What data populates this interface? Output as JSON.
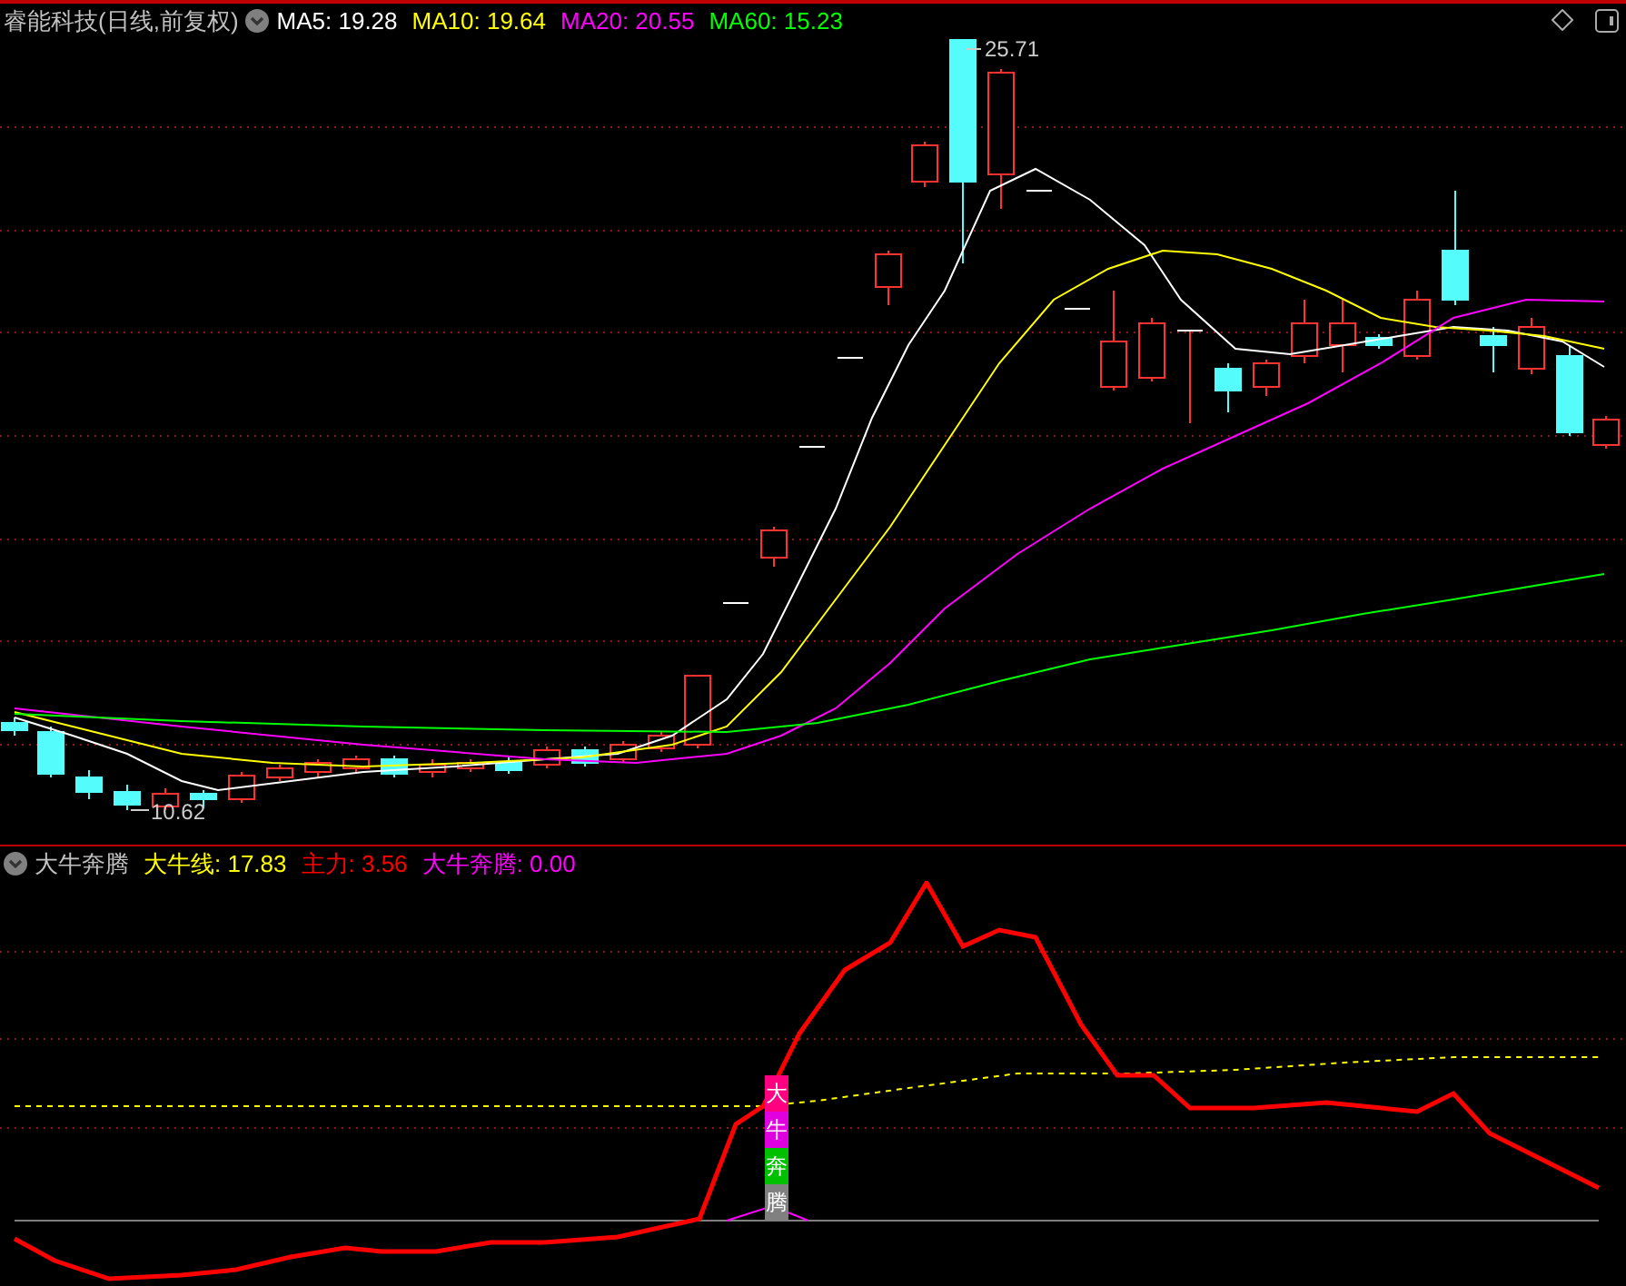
{
  "chart": {
    "title": "睿能科技(日线,前复权)",
    "legend": [
      {
        "label": "MA5: 19.28",
        "color": "#ffffff"
      },
      {
        "label": "MA10: 19.64",
        "color": "#ffff00"
      },
      {
        "label": "MA20: 20.55",
        "color": "#ff00ff"
      },
      {
        "label": "MA60: 15.23",
        "color": "#00ff00"
      }
    ],
    "high_label": "25.71",
    "low_label": "10.62"
  },
  "indicator": {
    "title": "大牛奔腾",
    "legend": [
      {
        "label": "大牛线: 17.83",
        "color": "#ffff00"
      },
      {
        "label": "主力: 3.56",
        "color": "#ff0000"
      },
      {
        "label": "大牛奔腾: 0.00",
        "color": "#ff00ff"
      }
    ],
    "signal": [
      {
        "char": "大",
        "color": "#ff0080"
      },
      {
        "char": "牛",
        "color": "#e000e0"
      },
      {
        "char": "奔",
        "color": "#00c000"
      },
      {
        "char": "腾",
        "color": "#808080"
      }
    ]
  }
}
